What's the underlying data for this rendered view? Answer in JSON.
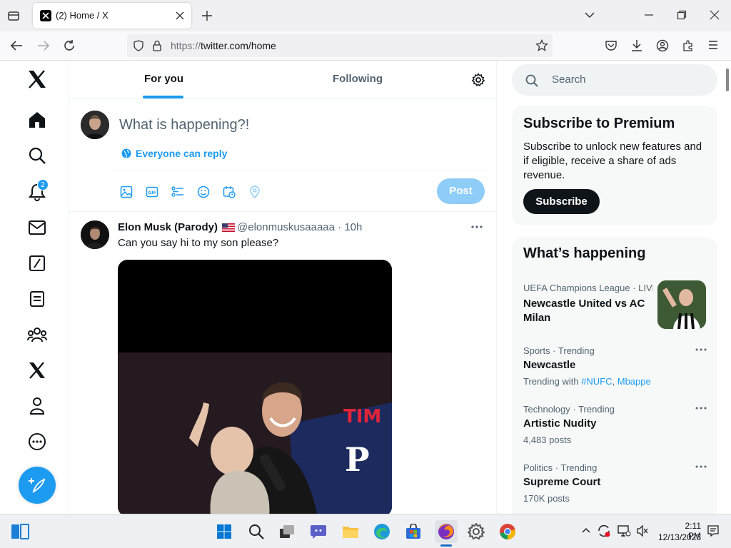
{
  "browser": {
    "tab_title": "(2) Home / X",
    "url_protocol": "https://",
    "url_rest": "twitter.com/home"
  },
  "leftnav": {
    "notification_count": "2"
  },
  "main": {
    "tabs": [
      {
        "label": "For you",
        "active": true
      },
      {
        "label": "Following",
        "active": false
      }
    ],
    "composer": {
      "placeholder": "What is happening?!",
      "reply_setting": "Everyone can reply",
      "post_label": "Post"
    },
    "tweet": {
      "name": "Elon Musk (Parody)",
      "handle": "@elonmuskusaaaaa",
      "time": "10h",
      "text": "Can you say hi to my son please?",
      "media_caption_text": "TIM"
    }
  },
  "right": {
    "search_placeholder": "Search",
    "premium": {
      "title": "Subscribe to Premium",
      "body": "Subscribe to unlock new features and if eligible, receive a share of ads revenue.",
      "button": "Subscribe"
    },
    "happening": {
      "title": "What’s happening",
      "trends": [
        {
          "context": "UEFA Champions League · LIVE",
          "name": "Newcastle United vs AC Milan",
          "sub": ""
        },
        {
          "context": "Sports · Trending",
          "name": "Newcastle",
          "sub_prefix": "Trending with ",
          "links": [
            "#NUFC",
            "Mbappe"
          ]
        },
        {
          "context": "Technology · Trending",
          "name": "Artistic Nudity",
          "sub": "4,483 posts"
        },
        {
          "context": "Politics · Trending",
          "name": "Supreme Court",
          "sub": "170K posts"
        }
      ]
    }
  },
  "taskbar": {
    "time": "2:11 PM",
    "date": "12/13/2023"
  },
  "colors": {
    "accent": "#1d9bf0",
    "post_disabled": "#8ecdf8",
    "text": "#0f1419",
    "muted": "#536471"
  }
}
